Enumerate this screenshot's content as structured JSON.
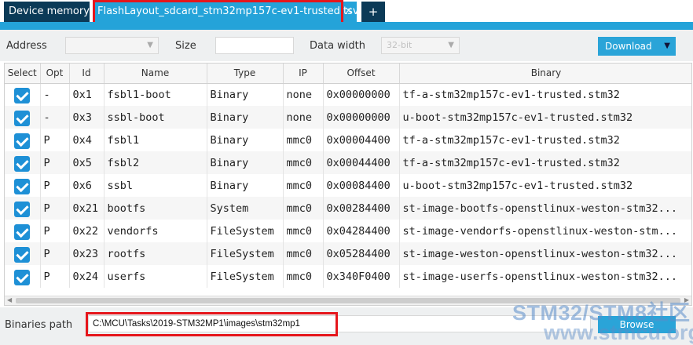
{
  "tabs": {
    "device_memory": "Device memory",
    "flash_layout": "FlashLayout_sdcard_stm32mp157c-ev1-trusted.tsv",
    "close_glyph": "✕",
    "add_glyph": "+"
  },
  "toolbar": {
    "address_label": "Address",
    "address_value": "",
    "size_label": "Size",
    "size_value": "",
    "data_width_label": "Data width",
    "data_width_value": "32-bit",
    "download_label": "Download",
    "download_caret": "▼"
  },
  "table": {
    "headers": [
      "Select",
      "Opt",
      "Id",
      "Name",
      "Type",
      "IP",
      "Offset",
      "Binary"
    ],
    "rows": [
      {
        "select": true,
        "opt": "-",
        "id": "0x1",
        "name": "fsbl1-boot",
        "type": "Binary",
        "ip": "none",
        "offset": "0x00000000",
        "binary": "tf-a-stm32mp157c-ev1-trusted.stm32"
      },
      {
        "select": true,
        "opt": "-",
        "id": "0x3",
        "name": "ssbl-boot",
        "type": "Binary",
        "ip": "none",
        "offset": "0x00000000",
        "binary": "u-boot-stm32mp157c-ev1-trusted.stm32"
      },
      {
        "select": true,
        "opt": "P",
        "id": "0x4",
        "name": "fsbl1",
        "type": "Binary",
        "ip": "mmc0",
        "offset": "0x00004400",
        "binary": "tf-a-stm32mp157c-ev1-trusted.stm32"
      },
      {
        "select": true,
        "opt": "P",
        "id": "0x5",
        "name": "fsbl2",
        "type": "Binary",
        "ip": "mmc0",
        "offset": "0x00044400",
        "binary": "tf-a-stm32mp157c-ev1-trusted.stm32"
      },
      {
        "select": true,
        "opt": "P",
        "id": "0x6",
        "name": "ssbl",
        "type": "Binary",
        "ip": "mmc0",
        "offset": "0x00084400",
        "binary": "u-boot-stm32mp157c-ev1-trusted.stm32"
      },
      {
        "select": true,
        "opt": "P",
        "id": "0x21",
        "name": "bootfs",
        "type": "System",
        "ip": "mmc0",
        "offset": "0x00284400",
        "binary": "st-image-bootfs-openstlinux-weston-stm32..."
      },
      {
        "select": true,
        "opt": "P",
        "id": "0x22",
        "name": "vendorfs",
        "type": "FileSystem",
        "ip": "mmc0",
        "offset": "0x04284400",
        "binary": "st-image-vendorfs-openstlinux-weston-stm..."
      },
      {
        "select": true,
        "opt": "P",
        "id": "0x23",
        "name": "rootfs",
        "type": "FileSystem",
        "ip": "mmc0",
        "offset": "0x05284400",
        "binary": "st-image-weston-openstlinux-weston-stm32..."
      },
      {
        "select": true,
        "opt": "P",
        "id": "0x24",
        "name": "userfs",
        "type": "FileSystem",
        "ip": "mmc0",
        "offset": "0x340F0400",
        "binary": "st-image-userfs-openstlinux-weston-stm32..."
      }
    ]
  },
  "bottom": {
    "binaries_path_label": "Binaries path",
    "binaries_path_value": "C:\\MCU\\Tasks\\2019-STM32MP1\\images\\stm32mp1",
    "browse_label": "Browse"
  },
  "watermark": {
    "line1": "STM32/STM8社区",
    "line2": "www.stmcu.org"
  },
  "colors": {
    "accent": "#24a3d9",
    "dark_tab": "#0b3a57",
    "highlight": "#e5161c",
    "checkbox": "#1e90d6"
  }
}
